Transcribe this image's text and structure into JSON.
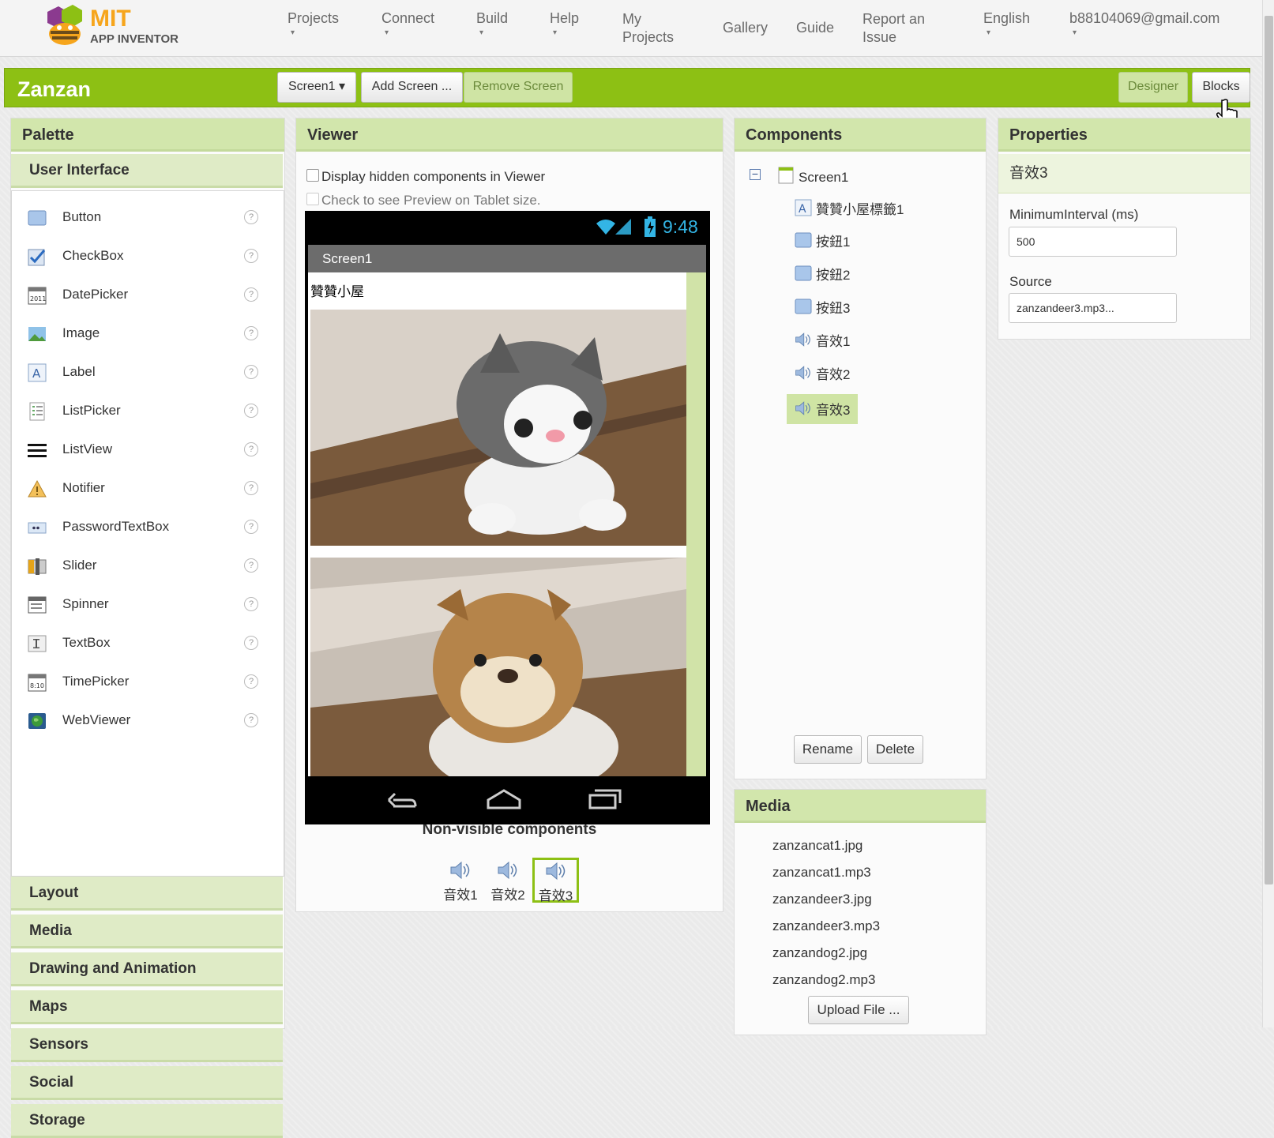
{
  "app": {
    "name_line1": "MIT",
    "name_line2": "APP INVENTOR"
  },
  "nav": {
    "projects": "Projects",
    "connect": "Connect",
    "build": "Build",
    "help": "Help",
    "my_projects_1": "My",
    "my_projects_2": "Projects",
    "gallery": "Gallery",
    "guide": "Guide",
    "report_1": "Report an",
    "report_2": "Issue",
    "language": "English",
    "account": "b88104069@gmail.com",
    "caret": "▾"
  },
  "project": {
    "name": "Zanzan",
    "screen_select": "Screen1 ▾",
    "add_screen": "Add Screen ...",
    "remove_screen": "Remove Screen",
    "designer": "Designer",
    "blocks": "Blocks"
  },
  "palette": {
    "title": "Palette",
    "open_category": "User Interface",
    "items": [
      {
        "label": "Button",
        "icon": "button-icon"
      },
      {
        "label": "CheckBox",
        "icon": "checkbox-icon"
      },
      {
        "label": "DatePicker",
        "icon": "datepicker-icon"
      },
      {
        "label": "Image",
        "icon": "image-icon"
      },
      {
        "label": "Label",
        "icon": "label-icon"
      },
      {
        "label": "ListPicker",
        "icon": "listpicker-icon"
      },
      {
        "label": "ListView",
        "icon": "listview-icon"
      },
      {
        "label": "Notifier",
        "icon": "notifier-icon"
      },
      {
        "label": "PasswordTextBox",
        "icon": "password-icon"
      },
      {
        "label": "Slider",
        "icon": "slider-icon"
      },
      {
        "label": "Spinner",
        "icon": "spinner-icon"
      },
      {
        "label": "TextBox",
        "icon": "textbox-icon"
      },
      {
        "label": "TimePicker",
        "icon": "timepicker-icon"
      },
      {
        "label": "WebViewer",
        "icon": "webviewer-icon"
      }
    ],
    "help": "?",
    "datepicker_glyph": "2011",
    "timepicker_glyph": "8:10",
    "categories": [
      "Layout",
      "Media",
      "Drawing and Animation",
      "Maps",
      "Sensors",
      "Social",
      "Storage"
    ]
  },
  "viewer": {
    "title": "Viewer",
    "hidden_label": "Display hidden components in Viewer",
    "tablet_label": "Check to see Preview on Tablet size.",
    "time": "9:48",
    "screen_title": "Screen1",
    "label_text": "贊贊小屋",
    "nonvisible_title": "Non-visible components",
    "nonvisible": [
      "音效1",
      "音效2",
      "音效3"
    ]
  },
  "components": {
    "title": "Components",
    "collapse": "−",
    "root": "Screen1",
    "label_glyph": "A",
    "children": [
      "贊贊小屋標籤1",
      "按鈕1",
      "按鈕2",
      "按鈕3",
      "音效1",
      "音效2",
      "音效3"
    ],
    "rename": "Rename",
    "delete": "Delete"
  },
  "media": {
    "title": "Media",
    "files": [
      "zanzancat1.jpg",
      "zanzancat1.mp3",
      "zanzandeer3.jpg",
      "zanzandeer3.mp3",
      "zanzandog2.jpg",
      "zanzandog2.mp3"
    ],
    "upload": "Upload File ..."
  },
  "properties": {
    "title": "Properties",
    "component": "音效3",
    "min_interval_label": "MinimumInterval (ms)",
    "min_interval_value": "500",
    "source_label": "Source",
    "source_value": "zanzandeer3.mp3..."
  },
  "colors": {
    "accent": "#8dc014",
    "panel_header": "#d2e6ac",
    "selected": "#cfe4a4"
  }
}
